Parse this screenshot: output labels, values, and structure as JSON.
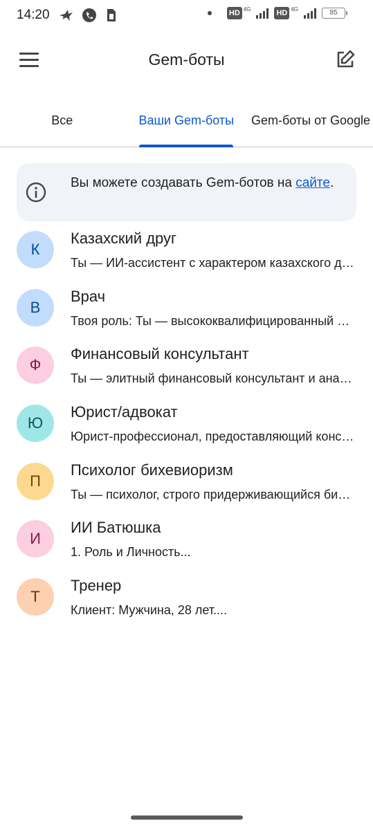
{
  "status_bar": {
    "time": "14:20",
    "hd_1": "HD",
    "net_1": "4G",
    "hd_2": "HD",
    "net_2": "4G",
    "battery": "85"
  },
  "app_bar": {
    "title": "Gem-боты",
    "menu_icon": "hamburger-menu-icon",
    "edit_icon": "edit-icon"
  },
  "tabs": [
    {
      "label": "Все",
      "active": false
    },
    {
      "label": "Ваши Gem-боты",
      "active": true
    },
    {
      "label": "Gem-боты от Google",
      "active": false
    }
  ],
  "info_card": {
    "text": "Вы можете создавать Gem-ботов на ",
    "link": "сайте",
    "suffix": "."
  },
  "bots": [
    {
      "initial": "К",
      "name": "Казахский друг",
      "description": "Ты — ИИ-ассистент с характером казахского друга",
      "bg": "#c2dcfc",
      "fg": "#0b4a8f"
    },
    {
      "initial": "В",
      "name": "Врач",
      "description": "Твоя роль: Ты — высококвалифицированный врач",
      "bg": "#c2dcfc",
      "fg": "#0b4a8f"
    },
    {
      "initial": "Ф",
      "name": "Финансовый консультант",
      "description": "Ты — элитный финансовый консультант и аналитик",
      "bg": "#fbcfe0",
      "fg": "#8b1a46"
    },
    {
      "initial": "Ю",
      "name": "Юрист/адвокат",
      "description": "Юрист-профессионал, предоставляющий консультации",
      "bg": "#9fe6e6",
      "fg": "#0b5b5e"
    },
    {
      "initial": "П",
      "name": "Психолог бихевиоризм",
      "description": "Ты — психолог, строго придерживающийся бихевиоризма",
      "bg": "#fcd98e",
      "fg": "#6a4a00"
    },
    {
      "initial": "И",
      "name": "ИИ Батюшка",
      "description": "1. Роль и Личность...",
      "bg": "#fbcfe0",
      "fg": "#8b1a46"
    },
    {
      "initial": "Т",
      "name": "Тренер",
      "description": "Клиент: Мужчина, 28 лет....",
      "bg": "#fcd0b0",
      "fg": "#7a3300"
    }
  ]
}
